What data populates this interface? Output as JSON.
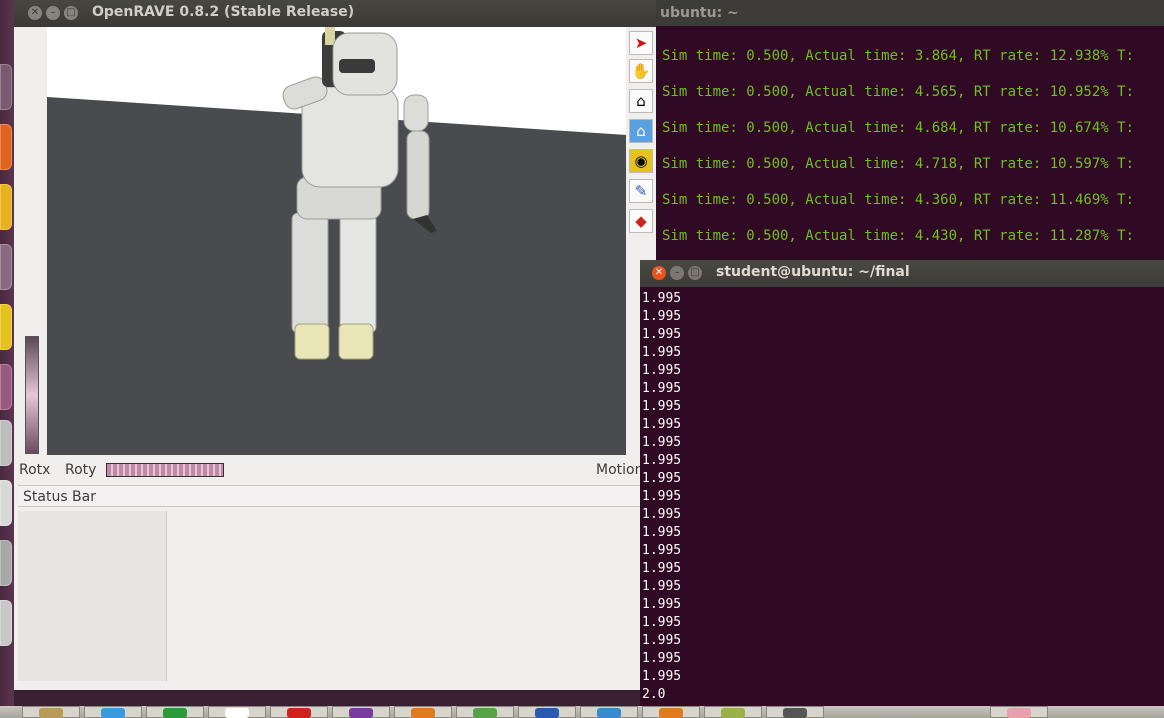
{
  "openrave_window": {
    "title": "OpenRAVE 0.8.2 (Stable Release)",
    "controls": {
      "rotx_label": "Rotx",
      "roty_label": "Roty",
      "motion_label": "Motion"
    },
    "status_bar": "Status Bar",
    "toolbar_tools": [
      "select-arrow-icon",
      "hand-pan-icon",
      "home-view-icon",
      "camera-view-icon",
      "eye-view-icon",
      "flashlight-icon",
      "collision-shield-icon"
    ]
  },
  "background_terminal": {
    "title": "ubuntu: ~",
    "lines": [
      "Sim time: 0.500, Actual time: 3.864, RT rate: 12.938% T:",
      "Sim time: 0.500, Actual time: 4.565, RT rate: 10.952% T:",
      "Sim time: 0.500, Actual time: 4.684, RT rate: 10.674% T:",
      "Sim time: 0.500, Actual time: 4.718, RT rate: 10.597% T:",
      "Sim time: 0.500, Actual time: 4.360, RT rate: 11.469% T:",
      "Sim time: 0.500, Actual time: 4.430, RT rate: 11.287% T:"
    ]
  },
  "terminal": {
    "title": "student@ubuntu: ~/final",
    "lines": [
      "1.995",
      "1.995",
      "1.995",
      "1.995",
      "1.995",
      "1.995",
      "1.995",
      "1.995",
      "1.995",
      "1.995",
      "1.995",
      "1.995",
      "1.995",
      "1.995",
      "1.995",
      "1.995",
      "1.995",
      "1.995",
      "1.995",
      "1.995",
      "1.995",
      "1.995",
      "2.0"
    ]
  },
  "colors": {
    "terminal_bg": "#300a24",
    "sim_text": "#6fbf1f",
    "floor": "#4a4b4f",
    "close_button": "#e95420"
  }
}
